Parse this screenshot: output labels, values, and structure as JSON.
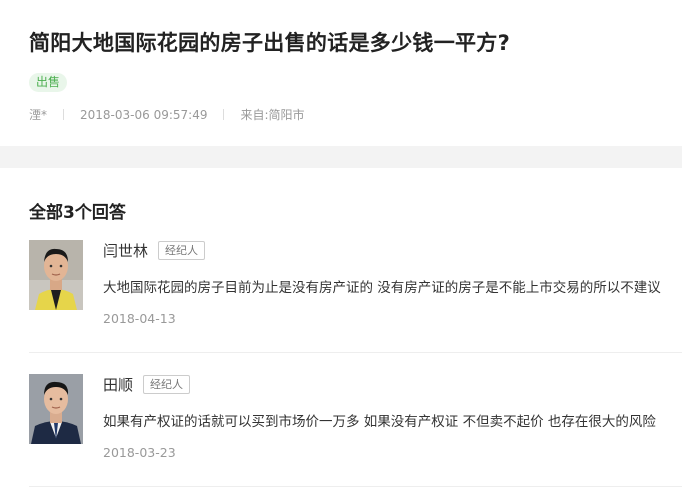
{
  "question": {
    "title": "简阳大地国际花园的房子出售的话是多少钱一平方?",
    "tag": "出售",
    "author": "湮*",
    "datetime": "2018-03-06 09:57:49",
    "source": "来自:简阳市"
  },
  "answers_section": {
    "heading": "全部3个回答",
    "answers": [
      {
        "name": "闫世林",
        "role": "经纪人",
        "text": "大地国际花园的房子目前为止是没有房产证的 没有房产证的房子是不能上市交易的所以不建议",
        "date": "2018-04-13",
        "avatar_icon": "agent-portrait-1"
      },
      {
        "name": "田顺",
        "role": "经纪人",
        "text": "如果有产权证的话就可以买到市场价一万多 如果没有产权证 不但卖不起价 也存在很大的风险",
        "date": "2018-03-23",
        "avatar_icon": "agent-portrait-2"
      }
    ]
  },
  "colors": {
    "tag_text": "#4caf50",
    "tag_bg": "#e9f6ea",
    "divider_band": "#f3f3f3"
  }
}
